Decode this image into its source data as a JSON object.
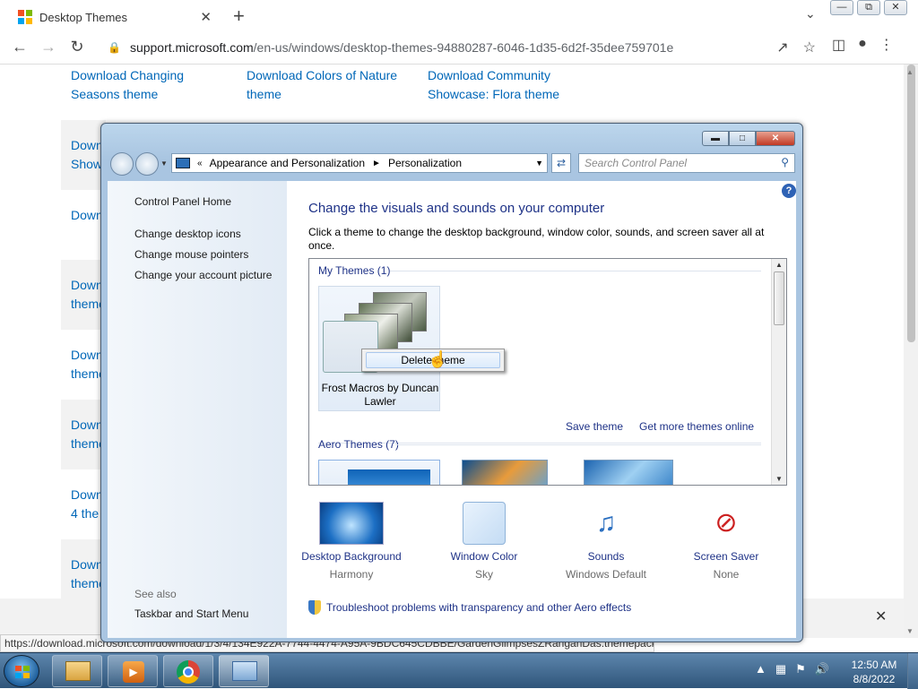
{
  "browser": {
    "tab_title": "Desktop Themes",
    "tab_close": "✕",
    "new_tab": "+",
    "url_host": "support.microsoft.com",
    "url_path": "/en-us/windows/desktop-themes-94880287-6046-1d35-6d2f-35dee759701e",
    "status_url": "https://download.microsoft.com/download/1/3/4/134E922A-7744-4474-A95A-9BDC645CDBBE/GardenGlimpsesZRanganDas.themepack"
  },
  "webpage": {
    "top_links": [
      "Download Changing Seasons theme",
      "Download Colors of Nature theme",
      "Download Community Showcase: Flora theme"
    ],
    "side_links": [
      [
        "Down",
        "Show"
      ],
      [
        "Down"
      ],
      [
        "Down",
        "theme"
      ],
      [
        "Down",
        "theme"
      ],
      [
        "Down",
        "theme"
      ],
      [
        "Down",
        "4 the"
      ],
      [
        "Down",
        "theme"
      ]
    ]
  },
  "control_panel": {
    "breadcrumb": [
      "Appearance and Personalization",
      "Personalization"
    ],
    "search_placeholder": "Search Control Panel",
    "left_nav": {
      "home": "Control Panel Home",
      "links": [
        "Change desktop icons",
        "Change mouse pointers",
        "Change your account picture"
      ],
      "see_also_label": "See also",
      "see_also_links": [
        "Taskbar and Start Menu"
      ]
    },
    "heading": "Change the visuals and sounds on your computer",
    "description": "Click a theme to change the desktop background, window color, sounds, and screen saver all at once.",
    "my_themes_label": "My Themes (1)",
    "my_theme_name": "Frost Macros by Duncan Lawler",
    "context_menu_item": "Delete theme",
    "save_theme": "Save theme",
    "get_more_themes": "Get more themes online",
    "aero_themes_label": "Aero Themes (7)",
    "tiles": [
      {
        "label": "Desktop Background",
        "sub": "Harmony"
      },
      {
        "label": "Window Color",
        "sub": "Sky"
      },
      {
        "label": "Sounds",
        "sub": "Windows Default"
      },
      {
        "label": "Screen Saver",
        "sub": "None"
      }
    ],
    "troubleshoot": "Troubleshoot problems with transparency and other Aero effects",
    "help": "?"
  },
  "taskbar": {
    "time": "12:50 AM",
    "date": "8/8/2022"
  },
  "colors": {
    "ms_link": "#0067b8",
    "cp_link": "#1e3287",
    "taskbar": "#2f557a"
  }
}
